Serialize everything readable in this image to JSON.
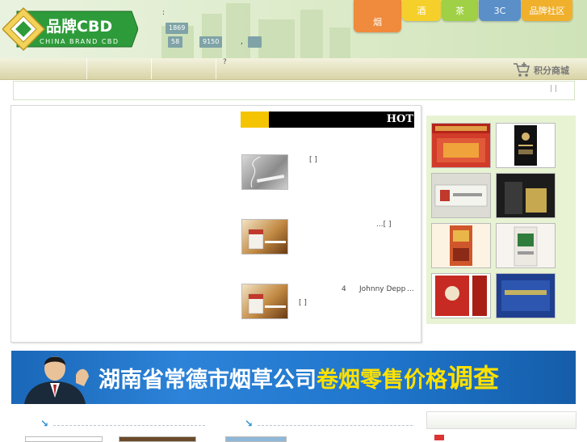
{
  "logo": {
    "brand_mark": "品牌CBD",
    "brand_subtitle": "CHINA BRAND CBD"
  },
  "header": {
    "colon": ":",
    "stats": {
      "first": "1869",
      "second": "58",
      "third": "9150"
    },
    "dot": ",",
    "tabs": [
      {
        "label": "烟",
        "color": "#f08a3c"
      },
      {
        "label": "酒",
        "color": "#f6d02a"
      },
      {
        "label": "茶",
        "color": "#9fd046"
      },
      {
        "label": "3C",
        "color": "#5b8fc8"
      },
      {
        "label": "品牌社区",
        "color": "#f0b02c"
      }
    ]
  },
  "navbar": {
    "question_mark": "?",
    "points_mall_label": "积分商城"
  },
  "notice": {
    "separators": "|   |"
  },
  "hot": {
    "label": "HOT",
    "items": [
      {
        "text": "[ ]"
      },
      {
        "text": "...[ ]"
      },
      {
        "number": "4",
        "name": "Johnny Depp",
        "ellipsis": "...",
        "text": "[ ]"
      }
    ]
  },
  "banner": {
    "text_white": "湖南省常德市烟草公司",
    "text_yellow": "卷烟零售价格",
    "text_emph": "调查"
  },
  "sections": {
    "arrow": "↘"
  },
  "colors": {
    "accent_green": "#9fd046",
    "banner_blue": "#1f76cc",
    "hot_yellow": "#f5c400"
  }
}
